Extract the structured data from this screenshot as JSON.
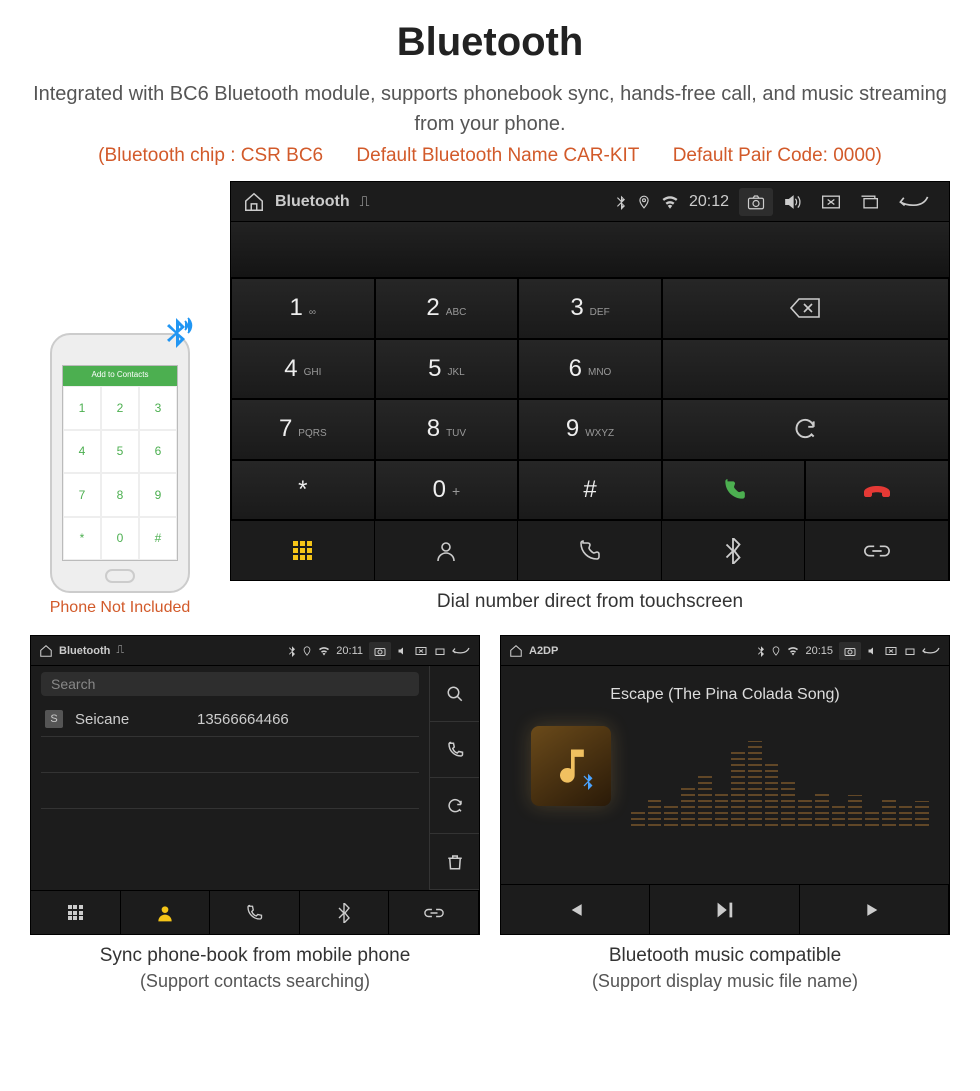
{
  "header": {
    "title": "Bluetooth",
    "desc": "Integrated with BC6 Bluetooth module, supports phonebook sync, hands-free call, and music streaming from your phone.",
    "spec1": "(Bluetooth chip : CSR BC6",
    "spec2": "Default Bluetooth Name CAR-KIT",
    "spec3": "Default Pair Code: 0000)"
  },
  "phone": {
    "caption": "Phone Not Included",
    "header": "Add to Contacts"
  },
  "main_screen": {
    "status_title": "Bluetooth",
    "time": "20:12",
    "keys": [
      {
        "num": "1",
        "sub": "∞"
      },
      {
        "num": "2",
        "sub": "ABC"
      },
      {
        "num": "3",
        "sub": "DEF"
      },
      {
        "num": "4",
        "sub": "GHI"
      },
      {
        "num": "5",
        "sub": "JKL"
      },
      {
        "num": "6",
        "sub": "MNO"
      },
      {
        "num": "7",
        "sub": "PQRS"
      },
      {
        "num": "8",
        "sub": "TUV"
      },
      {
        "num": "9",
        "sub": "WXYZ"
      },
      {
        "num": "*",
        "sub": ""
      },
      {
        "num": "0",
        "sub": "+",
        "supPlus": true
      },
      {
        "num": "#",
        "sub": ""
      }
    ],
    "caption": "Dial number direct from touchscreen"
  },
  "contacts_screen": {
    "status_title": "Bluetooth",
    "time": "20:11",
    "search_placeholder": "Search",
    "contact_name": "Seicane",
    "contact_number": "13566664466",
    "contact_badge": "S",
    "caption": "Sync phone-book from mobile phone",
    "caption_sub": "(Support contacts searching)"
  },
  "music_screen": {
    "status_title": "A2DP",
    "time": "20:15",
    "song_title": "Escape (The Pina Colada Song)",
    "caption": "Bluetooth music compatible",
    "caption_sub": "(Support display music file name)"
  }
}
